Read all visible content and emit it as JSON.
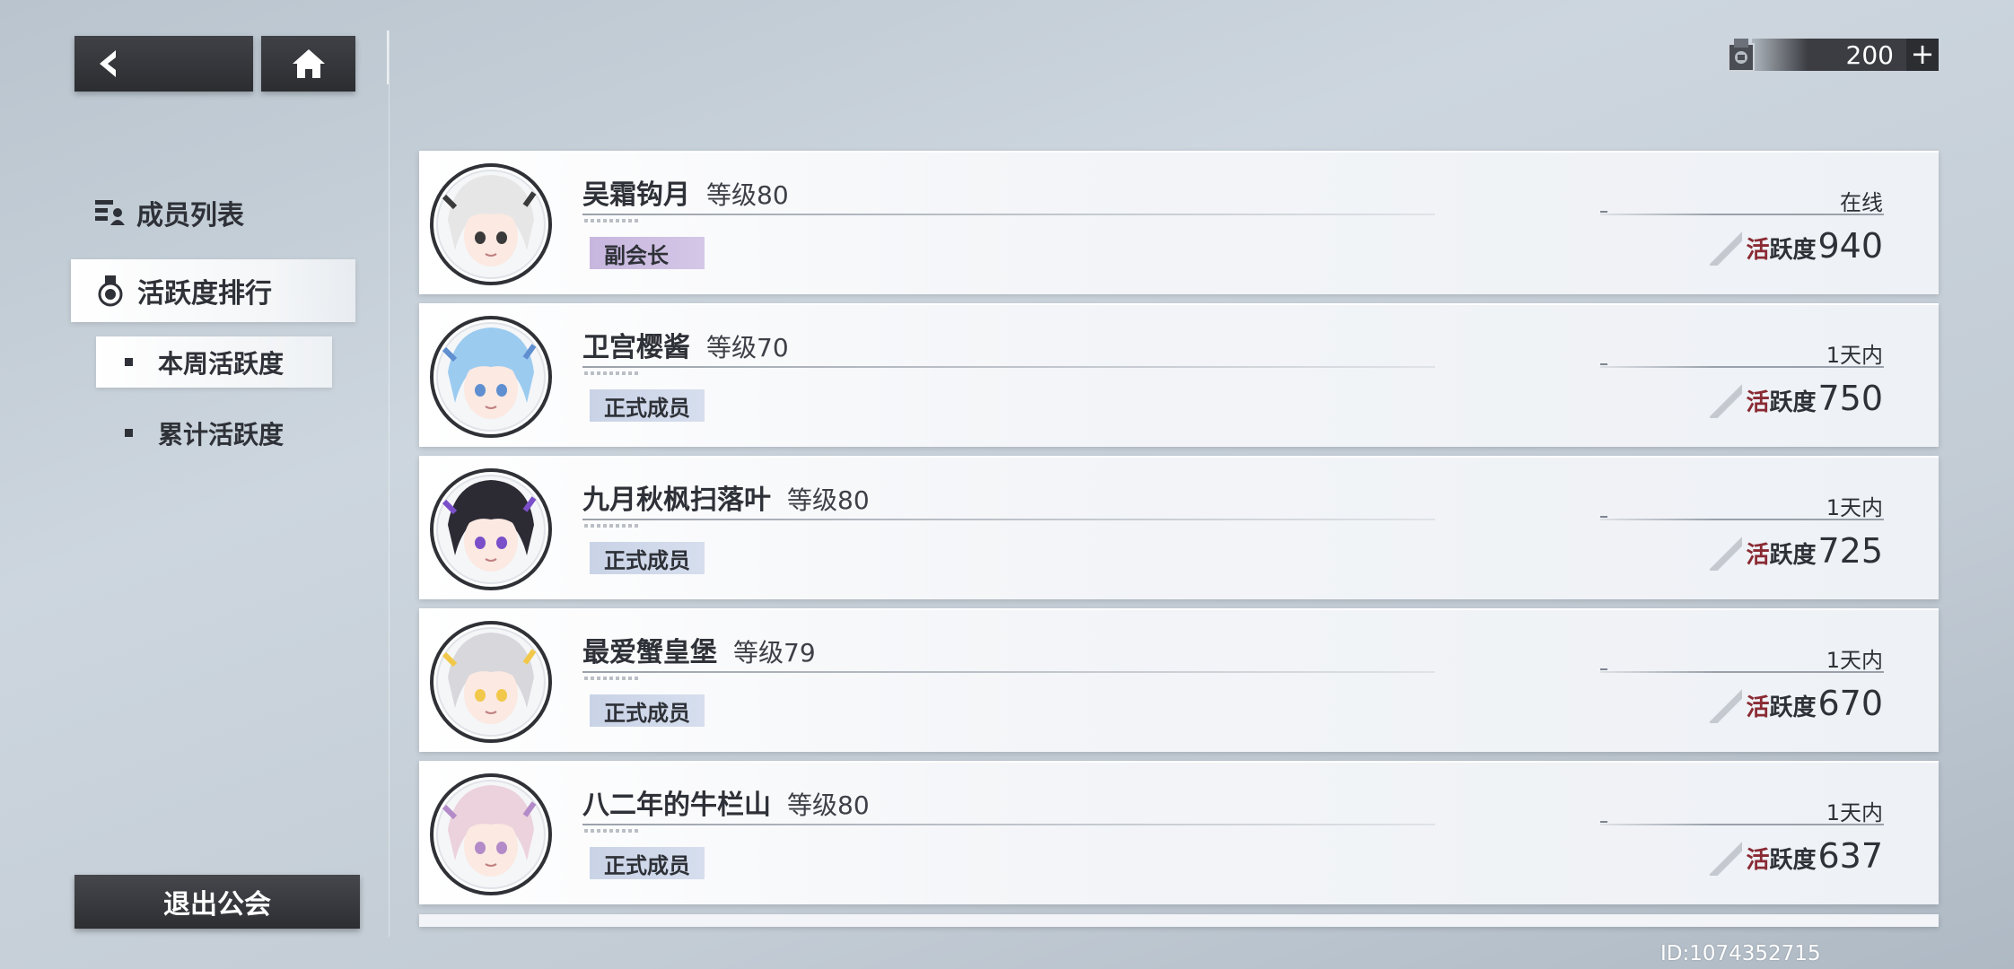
{
  "currency": {
    "amount": "200",
    "plus": "+"
  },
  "nav": {
    "members": "成员列表",
    "activity_rank": "活跃度排行",
    "weekly": "本周活跃度",
    "total": "累计活跃度"
  },
  "quit_label": "退出公会",
  "activity_prefix": "活",
  "activity_suffix": "跃度",
  "members": [
    {
      "name": "吴霜钩月",
      "level": "等级80",
      "role": "副会长",
      "status": "在线",
      "activity": "940",
      "role_type": "vice",
      "avatar_hair": "#e6e6e6",
      "avatar_accent": "#3a3a3a"
    },
    {
      "name": "卫宫樱酱",
      "level": "等级70",
      "role": "正式成员",
      "status": "1天内",
      "activity": "750",
      "role_type": "member",
      "avatar_hair": "#9ccbf0",
      "avatar_accent": "#5f8fd0"
    },
    {
      "name": "九月秋枫扫落叶",
      "level": "等级80",
      "role": "正式成员",
      "status": "1天内",
      "activity": "725",
      "role_type": "member",
      "avatar_hair": "#2c2a33",
      "avatar_accent": "#7a4fc9"
    },
    {
      "name": "最爱蟹皇堡",
      "level": "等级79",
      "role": "正式成员",
      "status": "1天内",
      "activity": "670",
      "role_type": "member",
      "avatar_hair": "#d8d8dc",
      "avatar_accent": "#f2c84b"
    },
    {
      "name": "八二年的牛栏山",
      "level": "等级80",
      "role": "正式成员",
      "status": "1天内",
      "activity": "637",
      "role_type": "member",
      "avatar_hair": "#ecd2dc",
      "avatar_accent": "#b38bc8"
    }
  ],
  "footer_id": "ID:1074352715"
}
